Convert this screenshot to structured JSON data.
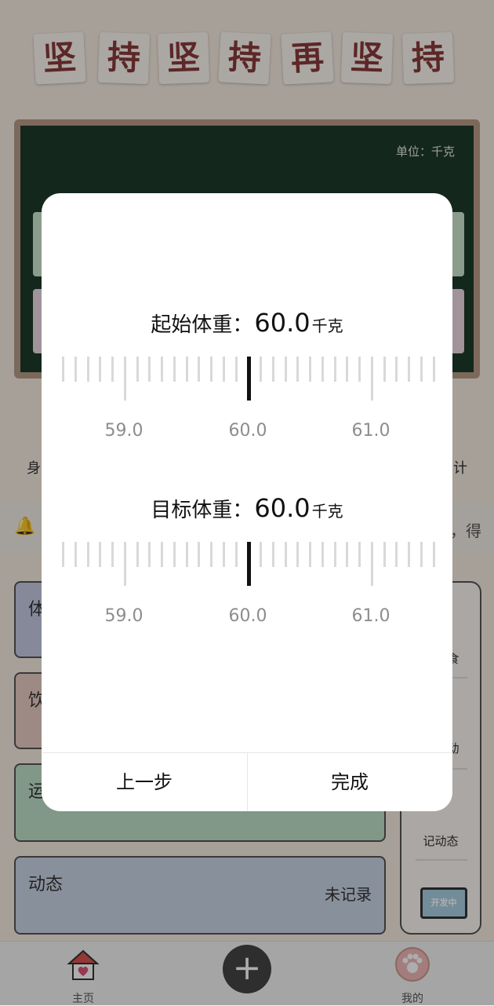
{
  "banner": {
    "chars": [
      "坚",
      "持",
      "坚",
      "持",
      "再",
      "坚",
      "持"
    ]
  },
  "board": {
    "unit": "单位：千克"
  },
  "stats": {
    "left_partial": "身",
    "right_partial": "计"
  },
  "notice": {
    "tail": "，得"
  },
  "cards": [
    {
      "title": "体",
      "status": ""
    },
    {
      "title": "饮",
      "status": ""
    },
    {
      "title": "运",
      "status": ""
    },
    {
      "title": "动态",
      "status": "未记录"
    }
  ],
  "side": {
    "item_food_partial": "食",
    "item_move_partial": "动",
    "item_record": "记动态",
    "dev_sign": "开发中"
  },
  "nav": {
    "home": "主页",
    "me": "我的",
    "add": "+"
  },
  "dialog": {
    "start": {
      "label": "起始体重：",
      "value": "60.0",
      "unit": "千克",
      "ticks": [
        "59.0",
        "60.0",
        "61.0"
      ]
    },
    "target": {
      "label": "目标体重：",
      "value": "60.0",
      "unit": "千克",
      "ticks": [
        "59.0",
        "60.0",
        "61.0"
      ]
    },
    "prev_button": "上一步",
    "done_button": "完成"
  },
  "colors": {
    "accent": "#111111",
    "tile_text": "#8a3a3a",
    "board": "#1c3a2a"
  }
}
